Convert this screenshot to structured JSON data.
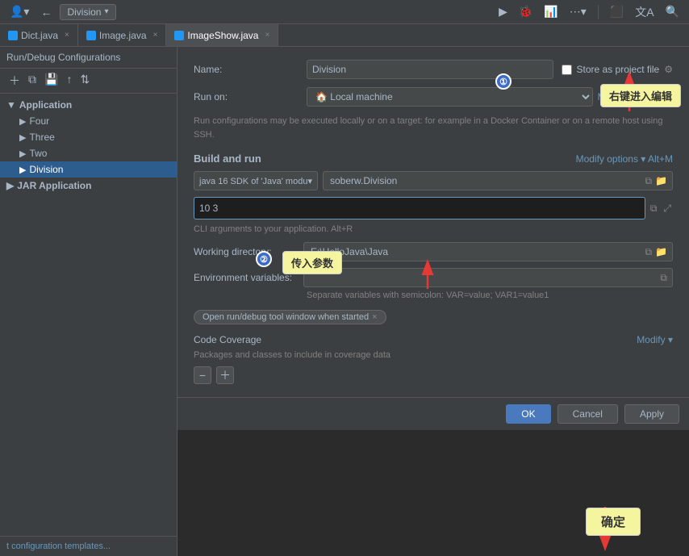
{
  "app": {
    "title": "Run/Debug Configurations"
  },
  "toolbar": {
    "run_config_label": "Division",
    "chevron": "▾"
  },
  "tabs": [
    {
      "label": "Dict.java",
      "active": false,
      "closeable": true
    },
    {
      "label": "Image.java",
      "active": false,
      "closeable": true
    },
    {
      "label": "ImageShow.java",
      "active": true,
      "closeable": true
    }
  ],
  "sidebar": {
    "title": "Run/Debug Configurations",
    "groups": [
      {
        "label": "Application",
        "expanded": true,
        "items": [
          {
            "label": "Four"
          },
          {
            "label": "Three"
          },
          {
            "label": "Two"
          },
          {
            "label": "Division",
            "selected": true
          }
        ]
      },
      {
        "label": "JAR Application",
        "expanded": false,
        "items": []
      }
    ],
    "bottom_link": "t configuration templates..."
  },
  "form": {
    "name_label": "Name:",
    "name_value": "Division",
    "store_label": "Store as project file",
    "run_on_label": "Run on:",
    "run_on_value": "🏠 Local machine",
    "manage_targets": "Manage targets...",
    "info_text": "Run configurations may be executed locally or on a target: for example in a Docker Container or on a remote host using SSH.",
    "build_run_title": "Build and run",
    "modify_options": "Modify options ▾  Alt+M",
    "sdk_label": "java 16  SDK of 'Java' modu▾",
    "class_value": "soberw.Division",
    "args_value": "10 3",
    "cli_hint": "CLI arguments to your application. Alt+R",
    "working_dir_label": "Working directory:",
    "working_dir_value": "E:\\HelloJava\\Java",
    "env_label": "Environment variables:",
    "env_hint": "Separate variables with semicolon: VAR=value; VAR1=value1",
    "chip_label": "Open run/debug tool window when started",
    "chip_close": "×",
    "coverage_title": "Code Coverage",
    "coverage_modify": "Modify ▾",
    "coverage_desc": "Packages and classes to include in coverage data"
  },
  "buttons": {
    "ok": "OK",
    "cancel": "Cancel",
    "apply": "Apply"
  },
  "callouts": {
    "callout1": "右键进入编辑",
    "callout2": "传入参数",
    "callout3": "确定"
  },
  "badges": {
    "badge1": "①",
    "badge2": "②"
  }
}
